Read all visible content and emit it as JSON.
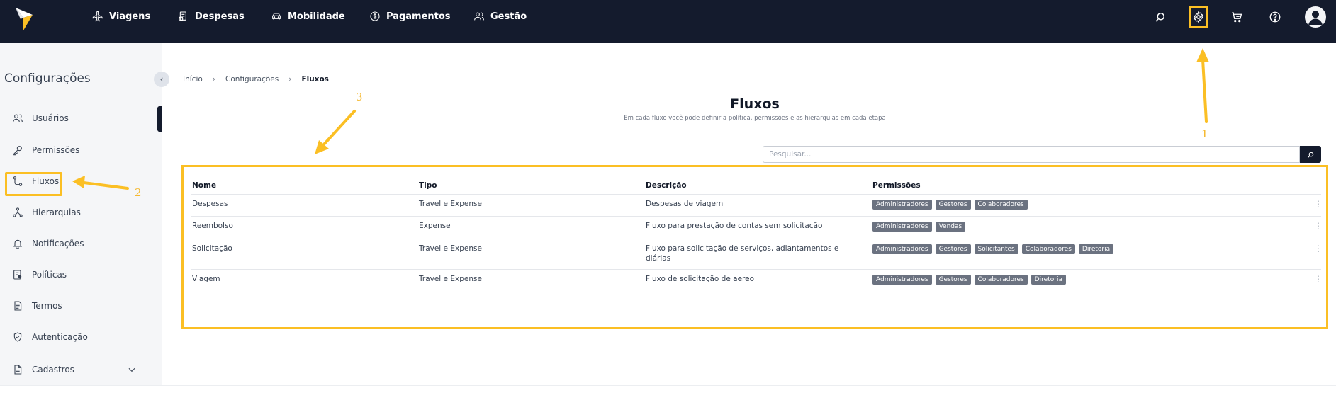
{
  "topnav": {
    "items": [
      {
        "label": "Viagens",
        "icon": "airplane-icon"
      },
      {
        "label": "Despesas",
        "icon": "receipt-icon"
      },
      {
        "label": "Mobilidade",
        "icon": "car-icon"
      },
      {
        "label": "Pagamentos",
        "icon": "dollar-icon"
      },
      {
        "label": "Gestão",
        "icon": "users-icon"
      }
    ]
  },
  "sidebar": {
    "title": "Configurações",
    "items": [
      {
        "label": "Usuários",
        "icon": "users-icon"
      },
      {
        "label": "Permissões",
        "icon": "key-icon"
      },
      {
        "label": "Fluxos",
        "icon": "flow-icon"
      },
      {
        "label": "Hierarquias",
        "icon": "hierarchy-icon"
      },
      {
        "label": "Notificações",
        "icon": "bell-icon"
      },
      {
        "label": "Políticas",
        "icon": "policy-icon"
      },
      {
        "label": "Termos",
        "icon": "document-icon"
      },
      {
        "label": "Autenticação",
        "icon": "shield-icon"
      },
      {
        "label": "Cadastros",
        "icon": "file-icon"
      }
    ]
  },
  "breadcrumb": {
    "items": [
      "Início",
      "Configurações",
      "Fluxos"
    ]
  },
  "page": {
    "title": "Fluxos",
    "subtitle": "Em cada fluxo você pode definir a política, permissões e as hierarquias em cada etapa"
  },
  "search": {
    "placeholder": "Pesquisar..."
  },
  "table": {
    "headers": [
      "Nome",
      "Tipo",
      "Descrição",
      "Permissões"
    ],
    "rows": [
      {
        "nome": "Despesas",
        "tipo": "Travel e Expense",
        "descricao": "Despesas de viagem",
        "descricao2": "",
        "permissoes": [
          "Administradores",
          "Gestores",
          "Colaboradores"
        ]
      },
      {
        "nome": "Reembolso",
        "tipo": "Expense",
        "descricao": "Fluxo para prestação de contas sem solicitação",
        "descricao2": "",
        "permissoes": [
          "Administradores",
          "Vendas"
        ]
      },
      {
        "nome": "Solicitação",
        "tipo": "Travel e Expense",
        "descricao": "Fluxo para solicitação de serviços, adiantamentos e",
        "descricao2": "diárias",
        "permissoes": [
          "Administradores",
          "Gestores",
          "Solicitantes",
          "Colaboradores",
          "Diretoria"
        ]
      },
      {
        "nome": "Viagem",
        "tipo": "Travel e Expense",
        "descricao": "Fluxo de solicitação de aereo",
        "descricao2": "",
        "permissoes": [
          "Administradores",
          "Gestores",
          "Colaboradores",
          "Diretoria"
        ]
      }
    ]
  },
  "annotations": {
    "one": "1",
    "two": "2",
    "three": "3"
  },
  "colors": {
    "topbar": "#141b2d",
    "highlight": "#fbbf24",
    "tag": "#6b7280"
  }
}
